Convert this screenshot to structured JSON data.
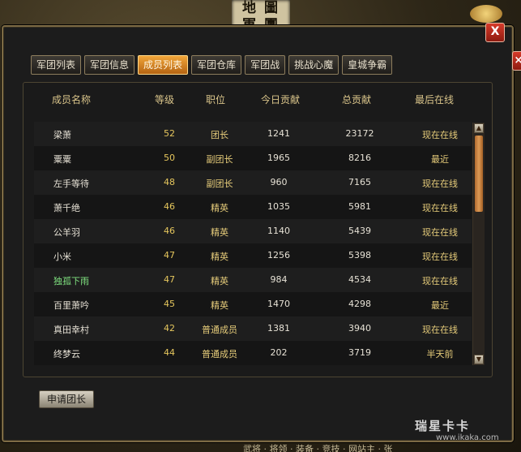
{
  "emblem": {
    "line1": "地 圖",
    "line2": "軍 團"
  },
  "tabs": [
    {
      "label": "军团列表"
    },
    {
      "label": "军团信息"
    },
    {
      "label": "成员列表",
      "active": true
    },
    {
      "label": "军团仓库"
    },
    {
      "label": "军团战"
    },
    {
      "label": "挑战心魔"
    },
    {
      "label": "皇城争霸"
    }
  ],
  "columns": {
    "name": "成员名称",
    "level": "等级",
    "position": "职位",
    "today": "今日贡献",
    "total": "总贡献",
    "last_online": "最后在线"
  },
  "members": [
    {
      "name": "梁萧",
      "level": "52",
      "position": "团长",
      "today": "1241",
      "total": "23172",
      "online": "现在在线"
    },
    {
      "name": "粟粟",
      "level": "50",
      "position": "副团长",
      "today": "1965",
      "total": "8216",
      "online": "最近"
    },
    {
      "name": "左手等待",
      "level": "48",
      "position": "副团长",
      "today": "960",
      "total": "7165",
      "online": "现在在线"
    },
    {
      "name": "萧千绝",
      "level": "46",
      "position": "精英",
      "today": "1035",
      "total": "5981",
      "online": "现在在线"
    },
    {
      "name": "公羊羽",
      "level": "46",
      "position": "精英",
      "today": "1140",
      "total": "5439",
      "online": "现在在线"
    },
    {
      "name": "小米",
      "level": "47",
      "position": "精英",
      "today": "1256",
      "total": "5398",
      "online": "现在在线"
    },
    {
      "name": "独孤下雨",
      "level": "47",
      "position": "精英",
      "today": "984",
      "total": "4534",
      "online": "现在在线",
      "highlight": true
    },
    {
      "name": "百里萧吟",
      "level": "45",
      "position": "精英",
      "today": "1470",
      "total": "4298",
      "online": "最近"
    },
    {
      "name": "真田幸村",
      "level": "42",
      "position": "普通成员",
      "today": "1381",
      "total": "3940",
      "online": "现在在线"
    },
    {
      "name": "终梦云",
      "level": "44",
      "position": "普通成员",
      "today": "202",
      "total": "3719",
      "online": "半天前"
    }
  ],
  "apply_button": "申请团长",
  "close_label": "X",
  "watermark": {
    "main": "瑞星卡卡",
    "url": "www.ikaka.com"
  },
  "bottom_strip": "武将 · 将领 · 装备 · 竞技 · 网站主 · 张"
}
